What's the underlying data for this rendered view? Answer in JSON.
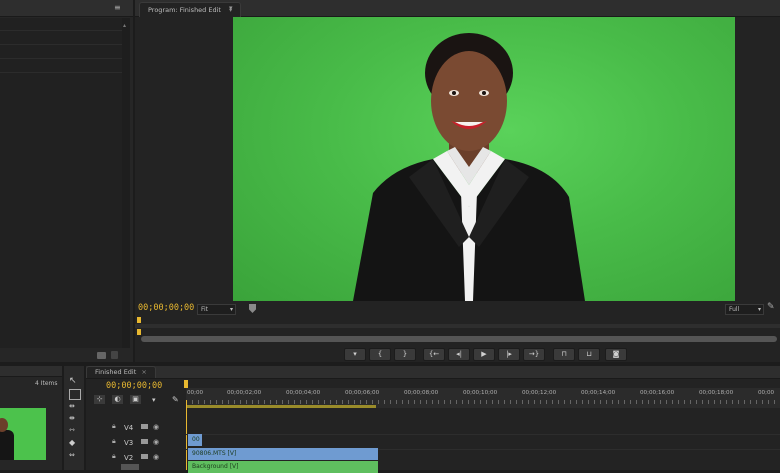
{
  "program_monitor": {
    "tab_label": "Program: Finished Edit",
    "timecode": "00;00;00;00",
    "fit_select": "Fit",
    "quality_select": "Full"
  },
  "project_panel": {
    "item_count": "4 Items"
  },
  "timeline": {
    "tab_label": "Finished Edit",
    "timecode": "00;00;00;00",
    "ruler_labels": [
      "00;00",
      "00;00;02;00",
      "00;00;04;00",
      "00;00;06;00",
      "00;00;08;00",
      "00;00;10;00",
      "00;00;12;00",
      "00;00;14;00",
      "00;00;16;00",
      "00;00;18;00",
      "00;00"
    ],
    "tracks": [
      {
        "name": "V4"
      },
      {
        "name": "V3"
      },
      {
        "name": "V2"
      }
    ],
    "clips": [
      {
        "label": "00"
      },
      {
        "label": "90806.MTS [V]"
      },
      {
        "label": "Background [V]"
      }
    ]
  },
  "colors": {
    "timecode": "#e8b830",
    "chroma_green": "#4cc24c",
    "clip_blue": "#6f9bd1",
    "clip_green": "#5fbf5f",
    "playhead": "#e8b830"
  },
  "icons": {
    "panel_menu": "panel-menu-icon",
    "wrench": "wrench-icon",
    "add_marker": "add-marker-icon",
    "mark_in": "mark-in-icon",
    "mark_out": "mark-out-icon",
    "go_to_in": "go-to-in-icon",
    "step_back": "step-back-icon",
    "play": "play-icon",
    "step_forward": "step-forward-icon",
    "go_to_out": "go-to-out-icon",
    "lift": "lift-icon",
    "extract": "extract-icon",
    "export_frame": "camera-icon"
  }
}
